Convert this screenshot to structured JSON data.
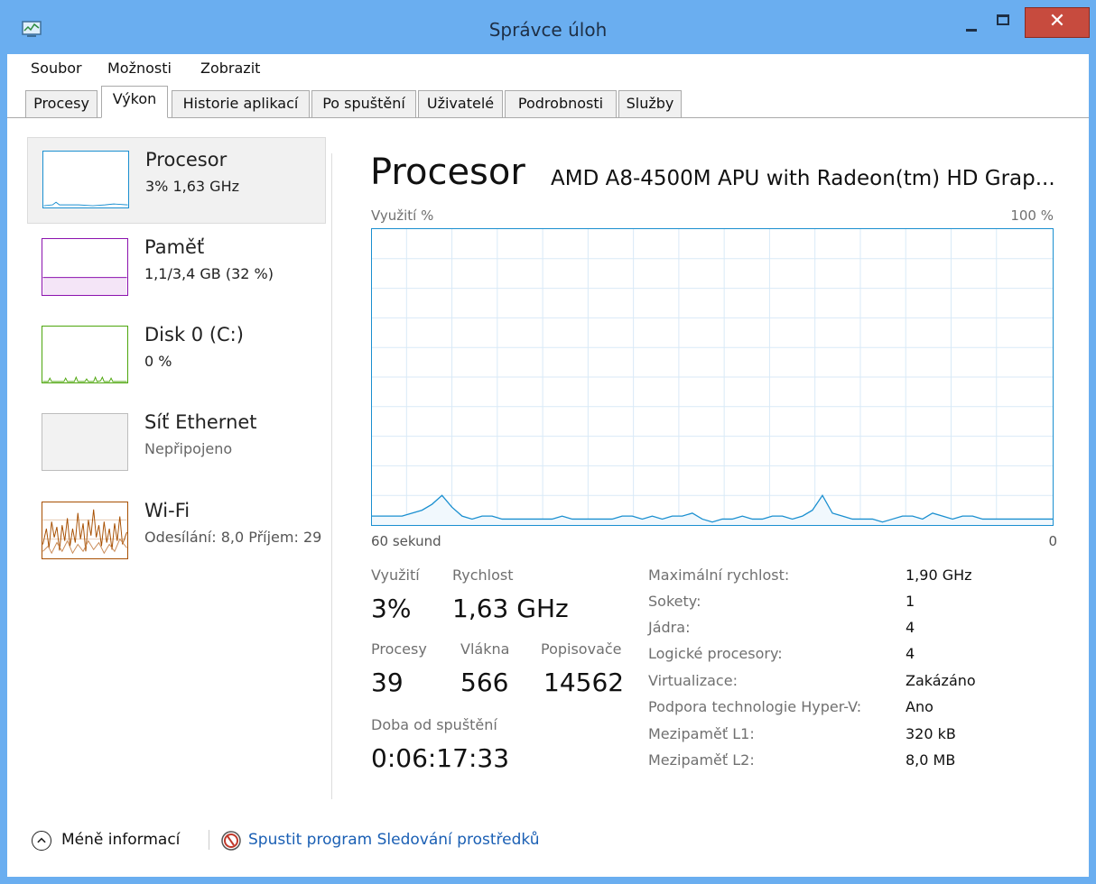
{
  "window": {
    "title": "Správce úloh",
    "close_glyph": "✕"
  },
  "menu": {
    "items": [
      "Soubor",
      "Možnosti",
      "Zobrazit"
    ]
  },
  "tabs": [
    "Procesy",
    "Výkon",
    "Historie aplikací",
    "Po spuštění",
    "Uživatelé",
    "Podrobnosti",
    "Služby"
  ],
  "active_tab": "Výkon",
  "sidebar": {
    "items": [
      {
        "title": "Procesor",
        "subtitle": "3% 1,63 GHz",
        "color": "#1a8fd0"
      },
      {
        "title": "Paměť",
        "subtitle": "1,1/3,4 GB (32 %)",
        "color": "#8b12ae"
      },
      {
        "title": "Disk 0 (C:)",
        "subtitle": "0 %",
        "color": "#4da60c"
      },
      {
        "title": "Síť Ethernet",
        "subtitle": "Nepřipojeno",
        "color": "#a0a0a0"
      },
      {
        "title": "Wi-Fi",
        "subtitle": "Odesílání: 8,0 Příjem: 29",
        "color": "#a74f01"
      }
    ]
  },
  "main": {
    "title": "Procesor",
    "cpu_name": "AMD A8-4500M APU with Radeon(tm) HD Grap...",
    "graph_label_left": "Využití %",
    "graph_label_right": "100 %",
    "graph_time_left": "60 sekund",
    "graph_time_right": "0",
    "graph_color": "#1a8fd0",
    "graph_grid_color": "#d9eaf7",
    "cpu_usage_history": [
      3,
      3,
      3,
      3,
      4,
      5,
      7,
      10,
      6,
      3,
      2,
      3,
      3,
      2,
      2,
      2,
      2,
      2,
      2,
      3,
      2,
      2,
      2,
      2,
      2,
      3,
      3,
      2,
      3,
      2,
      3,
      3,
      4,
      2,
      1,
      2,
      2,
      3,
      2,
      2,
      3,
      3,
      2,
      3,
      5,
      10,
      4,
      3,
      2,
      2,
      2,
      1,
      2,
      3,
      3,
      2,
      4,
      3,
      2,
      3,
      3,
      2,
      2,
      2,
      2,
      2,
      2,
      2,
      2
    ]
  },
  "stats": {
    "utilization_label": "Využití",
    "utilization": "3%",
    "speed_label": "Rychlost",
    "speed": "1,63 GHz",
    "processes_label": "Procesy",
    "processes": "39",
    "threads_label": "Vlákna",
    "threads": "566",
    "handles_label": "Popisovače",
    "handles": "14562",
    "uptime_label": "Doba od spuštění",
    "uptime": "0:06:17:33"
  },
  "info": [
    {
      "label": "Maximální rychlost:",
      "value": "1,90 GHz"
    },
    {
      "label": "Sokety:",
      "value": "1"
    },
    {
      "label": "Jádra:",
      "value": "4"
    },
    {
      "label": "Logické procesory:",
      "value": "4"
    },
    {
      "label": "Virtualizace:",
      "value": "Zakázáno"
    },
    {
      "label": "Podpora technologie Hyper-V:",
      "value": "Ano"
    },
    {
      "label": "Mezipaměť L1:",
      "value": "320 kB"
    },
    {
      "label": "Mezipaměť L2:",
      "value": "8,0 MB"
    }
  ],
  "footer": {
    "fewer_details": "Méně informací",
    "resource_monitor": "Spustit program Sledování prostředků"
  }
}
